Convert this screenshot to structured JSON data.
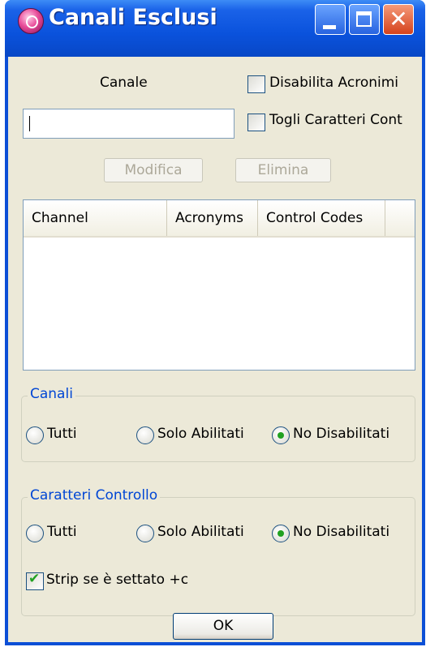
{
  "window": {
    "title": "Canali Esclusi",
    "icon": "app-logo-icon",
    "controls": {
      "minimize_icon": "minimize-icon",
      "maximize_icon": "maximize-icon",
      "close_symbol": "✕"
    }
  },
  "form": {
    "channel_label": "Canale",
    "channel_value": "",
    "disable_acronyms": {
      "label": "Disabilita Acronimi",
      "checked": false
    },
    "strip_control_chars": {
      "label": "Togli Caratteri Cont",
      "checked": false
    },
    "modify_label": "Modifica",
    "delete_label": "Elimina"
  },
  "list": {
    "columns": [
      "Channel",
      "Acronyms",
      "Control Codes"
    ],
    "rows": []
  },
  "channels_group": {
    "title": "Canali",
    "options": [
      "Tutti",
      "Solo Abilitati",
      "No Disabilitati"
    ],
    "selected": "No Disabilitati"
  },
  "control_chars_group": {
    "title": "Caratteri Controllo",
    "options": [
      "Tutti",
      "Solo Abilitati",
      "No Disabilitati"
    ],
    "selected": "No Disabilitati",
    "strip_c": {
      "label": "Strip se è settato +c",
      "checked": true
    }
  },
  "ok_label": "OK",
  "colors": {
    "titlebar": "#0a52dc",
    "group_title": "#0046d5",
    "dialog_bg": "#ece9d8",
    "check": "#21a121"
  }
}
